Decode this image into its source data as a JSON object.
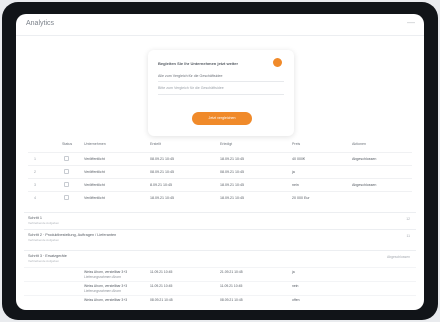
{
  "window": {
    "title": "Analytics"
  },
  "card": {
    "heading": "Begleiten Sie Ihr Unternehmen jetzt weiter",
    "line1": "Alle zum Vergleich für die Geschäftsidee",
    "line2": "Bitte zum Vergleich für die Geschäftsidee",
    "button": "Jetzt vergleichen"
  },
  "table": {
    "headers": [
      "Status",
      "Unternehmen",
      "Erstellt",
      "Erledigt",
      "Preis",
      "Aktionen"
    ],
    "rows": [
      {
        "num": "1",
        "company": "Veröffentlicht",
        "created": "08.09.21 10:45",
        "done": "18.09.21 10:45",
        "price": "40 000€",
        "action": "Abgeschlossen"
      },
      {
        "num": "2",
        "company": "Veröffentlicht",
        "created": "08.09.21 10:45",
        "done": "08.09.21 10:45",
        "price": "ja",
        "action": ""
      },
      {
        "num": "3",
        "company": "Veröffentlicht",
        "created": "8.09.21 10:45",
        "done": "18.09.21 10:45",
        "price": "nein",
        "action": "Abgeschlossen"
      },
      {
        "num": "4",
        "company": "Veröffentlicht",
        "created": "18.09.21 10:45",
        "done": "18.09.21 10:45",
        "price": "20 000 Eur",
        "action": ""
      }
    ]
  },
  "sections": [
    {
      "title": "Schritt 1",
      "sub": "Verbleibende Aufgaben",
      "right": "12"
    },
    {
      "title": "Schritt 2 · Produktbestellung, Auftragen / Lieferanten",
      "sub": "Verbleibende Aufgaben",
      "right": "11"
    },
    {
      "title": "Schritt 3 · Ersatzgeräte",
      "sub": "Verbleibende Aufgaben",
      "right": "Abgeschlossen"
    }
  ],
  "subrows": [
    {
      "name": "Weiss Ahorn, verstellbar 3+3",
      "name2": "Lieferungsrahmen Ahorn",
      "created": "11.09.21 10:45",
      "done": "21.09.21 10:45",
      "status": "ja"
    },
    {
      "name": "Weiss Ahorn, verstellbar 3+3",
      "name2": "Lieferungsrahmen Ahorn",
      "created": "11.09.21 10:45",
      "done": "11.09.21 10:45",
      "status": "nein"
    },
    {
      "name": "Weiss Ahorn, verstellbar 3+3",
      "name2": "",
      "created": "08.09.21 10:45",
      "done": "08.09.21 10:45",
      "status": "offen"
    }
  ]
}
